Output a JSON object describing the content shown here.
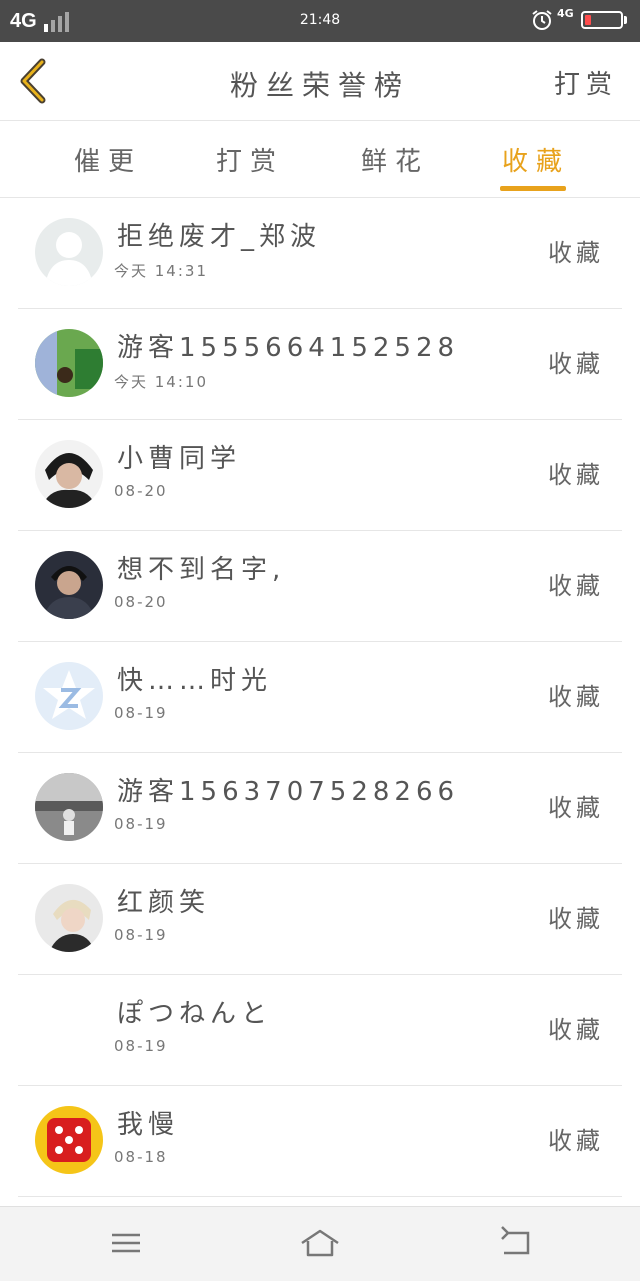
{
  "status_bar": {
    "network": "4G",
    "time": "21:48",
    "network_small": "4G"
  },
  "header": {
    "title": "粉丝荣誉榜",
    "reward_button": "打赏"
  },
  "tabs": [
    {
      "label": "催更"
    },
    {
      "label": "打赏"
    },
    {
      "label": "鲜花"
    },
    {
      "label": "收藏",
      "active": true
    }
  ],
  "fans": [
    {
      "name": "拒绝废才_郑波",
      "date": "今天 14:31",
      "action": "收藏"
    },
    {
      "name": "游客1555664152528",
      "date": "今天 14:10",
      "action": "收藏"
    },
    {
      "name": "小曹同学",
      "date": "08-20",
      "action": "收藏"
    },
    {
      "name": "想不到名字,",
      "date": "08-20",
      "action": "收藏"
    },
    {
      "name": "快……时光",
      "date": "08-19",
      "action": "收藏"
    },
    {
      "name": "游客1563707528266",
      "date": "08-19",
      "action": "收藏"
    },
    {
      "name": "红颜笑",
      "date": "08-19",
      "action": "收藏"
    },
    {
      "name": "ぽつねんと",
      "date": "08-19",
      "action": "收藏"
    },
    {
      "name": "我慢",
      "date": "08-18",
      "action": "收藏"
    }
  ],
  "colors": {
    "accent": "#e8a21c",
    "status_bar": "#4a4a4a",
    "text": "#555555",
    "divider": "#e6e6e6"
  },
  "icons": {
    "back": "chevron-left-icon",
    "menu": "menu-icon",
    "home": "home-icon",
    "return": "return-icon"
  }
}
